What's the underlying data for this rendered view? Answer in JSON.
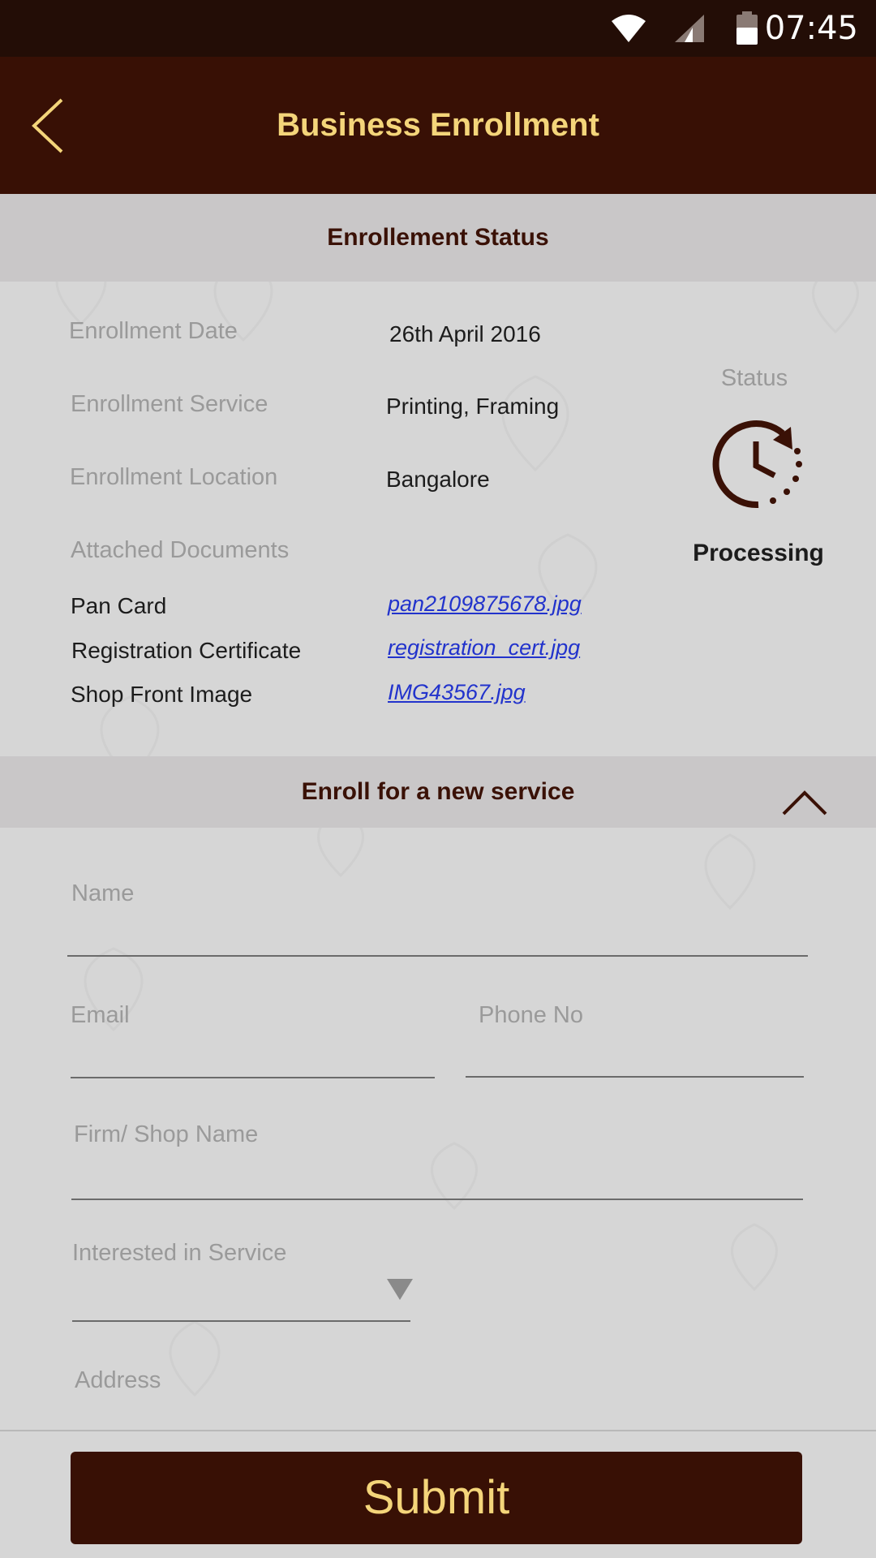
{
  "status_bar": {
    "time": "07:45",
    "icons": [
      "wifi-icon",
      "cell-signal-icon",
      "battery-icon"
    ]
  },
  "app_bar": {
    "title": "Business Enrollment",
    "back_icon": "back-arrow-icon"
  },
  "status_section": {
    "header": "Enrollement Status",
    "enrollment_date_label": "Enrollment Date",
    "enrollment_date_value": "26th April 2016",
    "enrollment_service_label": "Enrollment Service",
    "enrollment_service_value": "Printing, Framing",
    "enrollment_location_label": "Enrollment Location",
    "enrollment_location_value": "Bangalore",
    "attached_documents_label": "Attached Documents",
    "documents": [
      {
        "name": "Pan Card",
        "file": "pan2109875678.jpg"
      },
      {
        "name": "Registration Certificate",
        "file": "registration_cert.jpg"
      },
      {
        "name": "Shop Front Image",
        "file": "IMG43567.jpg"
      }
    ],
    "status_label": "Status",
    "status_value": "Processing",
    "status_icon": "clock-processing-icon"
  },
  "enroll_section": {
    "header": "Enroll for a new service",
    "collapse_icon": "chevron-up-icon",
    "fields": {
      "name": {
        "label": "Name",
        "value": ""
      },
      "email": {
        "label": "Email",
        "value": ""
      },
      "phone": {
        "label": "Phone No",
        "value": ""
      },
      "firm": {
        "label": "Firm/ Shop Name",
        "value": ""
      },
      "service": {
        "label": "Interested in Service",
        "value": ""
      },
      "address": {
        "label": "Address",
        "value": ""
      }
    },
    "submit_label": "Submit"
  },
  "colors": {
    "status_bar": "#230d06",
    "app_bar": "#381005",
    "accent_gold": "#f4d57a",
    "header_gray": "#c9c7c8",
    "background": "#d6d6d6",
    "link_blue": "#2233cc"
  }
}
